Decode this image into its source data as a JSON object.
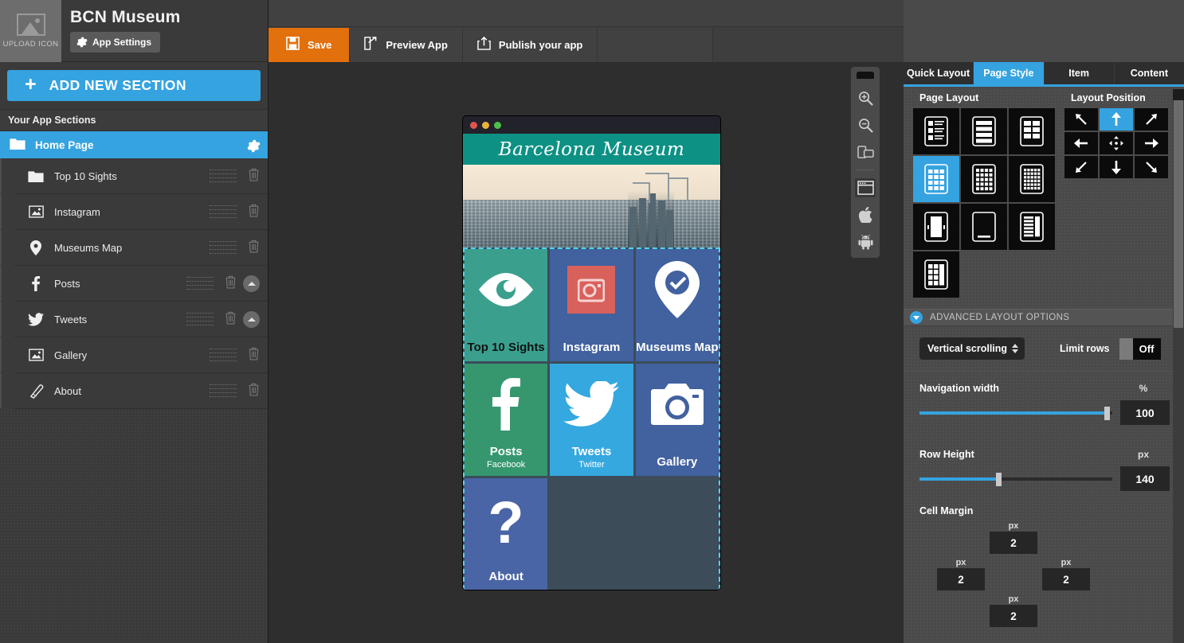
{
  "sidebar": {
    "upload_icon_label": "UPLOAD ICON",
    "app_title": "BCN Museum",
    "app_settings_label": "App Settings",
    "add_section_label": "ADD NEW SECTION",
    "add_section_plus": "+",
    "sections_header": "Your App Sections",
    "home_page_label": "Home Page",
    "sections": [
      {
        "label": "Top 10 Sights",
        "icon": "folder-icon",
        "has_reorder": false
      },
      {
        "label": "Instagram",
        "icon": "image-icon",
        "has_reorder": false
      },
      {
        "label": "Museums Map",
        "icon": "map-pin-icon",
        "has_reorder": false
      },
      {
        "label": "Posts",
        "icon": "facebook-icon",
        "has_reorder": true
      },
      {
        "label": "Tweets",
        "icon": "twitter-icon",
        "has_reorder": true
      },
      {
        "label": "Gallery",
        "icon": "image-icon",
        "has_reorder": false
      },
      {
        "label": "About",
        "icon": "pencil-icon",
        "has_reorder": false
      }
    ]
  },
  "toolbar": {
    "save_label": "Save",
    "preview_label": "Preview App",
    "publish_label": "Publish your app",
    "save_color": "#e2700d",
    "menu_icon": "list-menu-icon",
    "help_icon": "question-mark-icon",
    "help_glyph": "?"
  },
  "device_tools": {
    "items": [
      {
        "name": "zoom-in-icon"
      },
      {
        "name": "zoom-out-icon"
      },
      {
        "name": "rotate-device-icon"
      },
      {
        "name": "browser-window-icon",
        "selected": true
      },
      {
        "name": "apple-icon"
      },
      {
        "name": "android-icon"
      }
    ]
  },
  "preview": {
    "banner_title": "Barcelona Museum",
    "banner_color": "#0d9184",
    "window_dots": [
      "#e0544e",
      "#e8b33c",
      "#4cc04a"
    ],
    "tiles": [
      [
        {
          "label": "Top 10 Sights",
          "sub": "",
          "bg": "#3aa08d",
          "icon": "eye-icon",
          "label_dark": true
        },
        {
          "label": "Instagram",
          "sub": "",
          "bg": "#41619f",
          "icon": "instagram-icon",
          "label_dark": false
        },
        {
          "label": "Museums Map",
          "sub": "",
          "bg": "#41619f",
          "icon": "map-pin-check-icon",
          "label_dark": false
        }
      ],
      [
        {
          "label": "Posts",
          "sub": "Facebook",
          "bg": "#36976f",
          "icon": "facebook-icon",
          "label_dark": false
        },
        {
          "label": "Tweets",
          "sub": "Twitter",
          "bg": "#35a8e0",
          "icon": "twitter-icon",
          "label_dark": false
        },
        {
          "label": "Gallery",
          "sub": "",
          "bg": "#41619f",
          "icon": "camera-icon",
          "label_dark": false
        }
      ],
      [
        {
          "label": "About",
          "sub": "",
          "bg": "#4a65a5",
          "icon": "question-mark-icon",
          "label_dark": false
        },
        {
          "label": "",
          "sub": "",
          "bg": "#3c4c59",
          "icon": "",
          "label_dark": false
        },
        {
          "label": "",
          "sub": "",
          "bg": "#3c4c59",
          "icon": "",
          "label_dark": false
        }
      ]
    ]
  },
  "right_panel": {
    "tabs": [
      {
        "label": "Quick Layout",
        "active": false
      },
      {
        "label": "Page Style",
        "active": true
      },
      {
        "label": "Item",
        "active": false
      },
      {
        "label": "Content",
        "active": false
      }
    ],
    "page_layout_title": "Page Layout",
    "layout_position_title": "Layout Position",
    "layouts": [
      {
        "name": "list-detail-layout",
        "selected": false
      },
      {
        "name": "stacked-rows-layout",
        "selected": false
      },
      {
        "name": "two-column-grid-layout",
        "selected": false
      },
      {
        "name": "three-column-grid-layout",
        "selected": true
      },
      {
        "name": "four-column-grid-layout",
        "selected": false
      },
      {
        "name": "five-column-grid-layout",
        "selected": false
      },
      {
        "name": "carousel-layout",
        "selected": false
      },
      {
        "name": "blank-layout",
        "selected": false
      },
      {
        "name": "side-list-layout",
        "selected": false
      },
      {
        "name": "mixed-grid-layout",
        "selected": false
      }
    ],
    "positions": [
      {
        "name": "align-top-left",
        "selected": false
      },
      {
        "name": "align-top-center",
        "selected": true
      },
      {
        "name": "align-top-right",
        "selected": false
      },
      {
        "name": "align-middle-left",
        "selected": false
      },
      {
        "name": "align-center",
        "selected": false
      },
      {
        "name": "align-middle-right",
        "selected": false
      },
      {
        "name": "align-bottom-left",
        "selected": false
      },
      {
        "name": "align-bottom-center",
        "selected": false
      },
      {
        "name": "align-bottom-right",
        "selected": false
      }
    ],
    "advanced_title": "ADVANCED LAYOUT OPTIONS",
    "scroll_select_value": "Vertical scrolling",
    "limit_rows_label": "Limit rows",
    "limit_rows_state": "Off",
    "navigation_width": {
      "label": "Navigation width",
      "unit": "%",
      "value": "100",
      "fill_percent": 97
    },
    "row_height": {
      "label": "Row Height",
      "unit": "px",
      "value": "140",
      "fill_percent": 41
    },
    "cell_margin": {
      "label": "Cell Margin",
      "unit": "px",
      "top": "2",
      "left": "2",
      "right": "2",
      "bottom": "2"
    }
  }
}
